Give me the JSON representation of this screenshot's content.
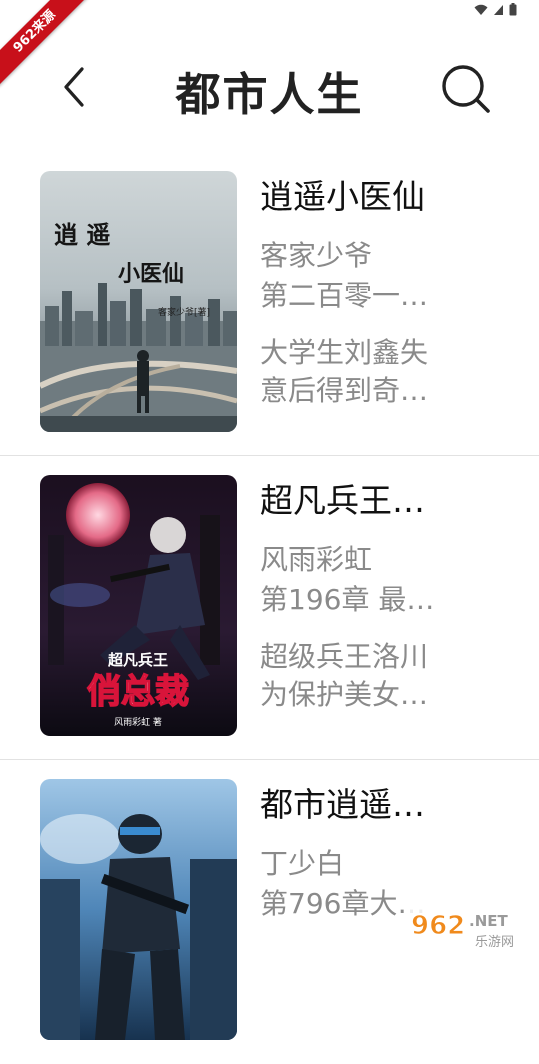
{
  "watermark": {
    "corner_text": "962来源",
    "site_logo_main": "962",
    "site_logo_suffix": ".NET",
    "site_logo_sub": "乐游网"
  },
  "header": {
    "title": "都市人生"
  },
  "books": [
    {
      "title": "逍遥小医仙",
      "author": "客家少爷",
      "chapter": "第二百零一…",
      "desc_line1": "大学生刘鑫失",
      "desc_line2": "意后得到奇…",
      "cover_title_1": "逍 遥",
      "cover_title_2": "小医仙",
      "cover_author": "客家少爷[著]"
    },
    {
      "title": "超凡兵王…",
      "author": "风雨彩虹",
      "chapter": "第196章 最…",
      "desc_line1": "超级兵王洛川",
      "desc_line2": "为保护美女…",
      "cover_title_1": "超凡兵王",
      "cover_title_2": "俏总裁",
      "cover_author": "风雨彩虹 著"
    },
    {
      "title": "都市逍遥…",
      "author": "丁少白",
      "chapter": "第796章大…",
      "desc_line1": "",
      "desc_line2": ""
    }
  ]
}
